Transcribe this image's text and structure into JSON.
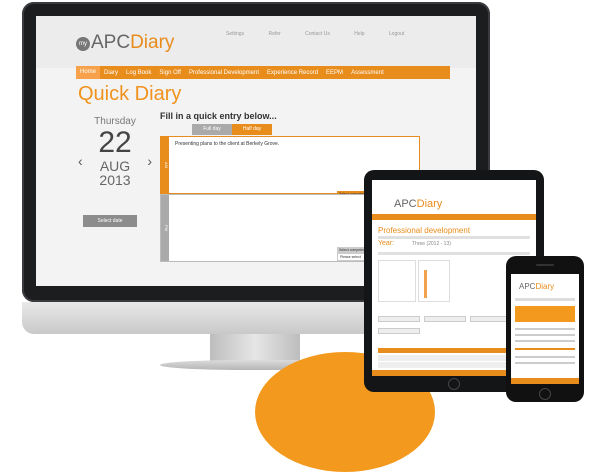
{
  "logo": {
    "prefix": "APC",
    "suffix": "Diary",
    "badge": "my"
  },
  "top_links": [
    "Settings",
    "Refer",
    "Contact Us",
    "Help",
    "Logout"
  ],
  "nav": [
    "Home",
    "Diary",
    "Log Book",
    "Sign Off",
    "Professional Development",
    "Experience Record",
    "EEPM",
    "Assessment"
  ],
  "page_title": "Quick Diary",
  "date": {
    "dow": "Thursday",
    "day": "22",
    "month": "AUG",
    "year": "2013",
    "select_label": "Select date"
  },
  "fill_in": "Fill in a quick entry below...",
  "tabs": {
    "full": "Full day",
    "half": "Half day"
  },
  "am": {
    "side": "AM",
    "text": "Presenting plans to the client at Berkely Grove.",
    "competency_label": "Select competency",
    "competency_value": "T082 Maintenance management"
  },
  "pm": {
    "side": "PM",
    "competency_label": "Select competency",
    "competency_value": "Please select"
  },
  "tablet": {
    "title": "Professional development",
    "year_label": "Year:",
    "year_value": "Three (2012 - 13)"
  }
}
